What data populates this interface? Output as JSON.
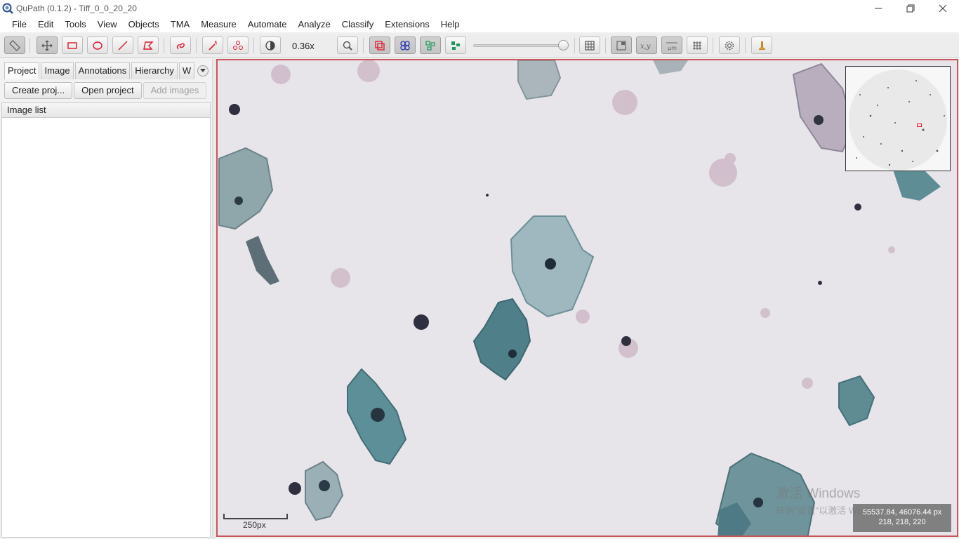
{
  "window": {
    "title": "QuPath (0.1.2) - Tiff_0_0_20_20",
    "icon": "qupath-logo-icon"
  },
  "menu": [
    "File",
    "Edit",
    "Tools",
    "View",
    "Objects",
    "TMA",
    "Measure",
    "Automate",
    "Analyze",
    "Classify",
    "Extensions",
    "Help"
  ],
  "toolbar": {
    "zoom": "0.36x",
    "tools": [
      "ruler-icon",
      "move-icon",
      "rectangle-icon",
      "ellipse-icon",
      "line-icon",
      "polygon-icon",
      "brush-icon",
      "wand-icon",
      "points-icon",
      "brightness-contrast-icon",
      "zoom-to-fit-icon",
      "show-annotations-icon",
      "show-tma-grid-icon",
      "show-detections-icon",
      "fill-detections-icon",
      "measurement-table-icon",
      "show-overview-icon",
      "show-location-icon",
      "show-scalebar-icon",
      "show-grid-icon",
      "preferences-icon",
      "log-icon"
    ]
  },
  "left_panel": {
    "tabs": [
      "Project",
      "Image",
      "Annotations",
      "Hierarchy",
      "W"
    ],
    "buttons": {
      "create": "Create proj...",
      "open": "Open project",
      "add": "Add images"
    },
    "list_header": "Image list"
  },
  "viewer": {
    "scalebar_label": "250px",
    "coords_line1": "55537.84, 46076.44 px",
    "coords_line2": "218, 218, 220",
    "border_color": "#c8565b"
  },
  "watermark": {
    "line1": "激活 Windows",
    "line2": "转到\"设置\"以激活 Windows。"
  }
}
